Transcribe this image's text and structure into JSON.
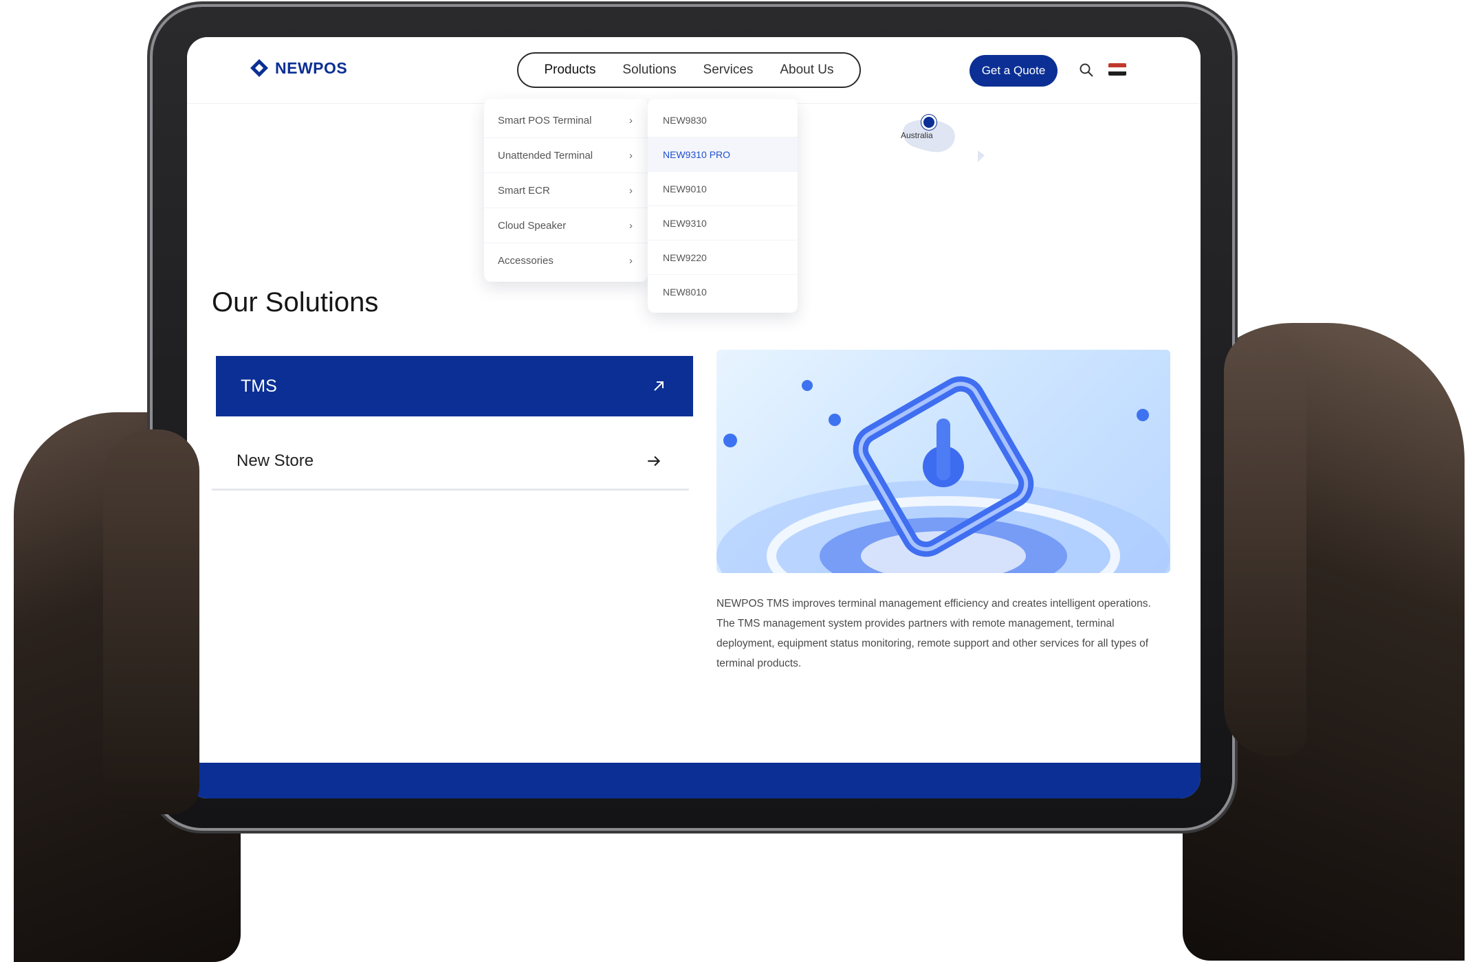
{
  "header": {
    "logo_text": "NEWPOS",
    "nav": [
      "Products",
      "Solutions",
      "Services",
      "About Us"
    ],
    "quote_button": "Get a Quote"
  },
  "products_menu": {
    "categories": [
      "Smart POS Terminal",
      "Unattended Terminal",
      "Smart ECR",
      "Cloud Speaker",
      "Accessories"
    ],
    "models": [
      "NEW9830",
      "NEW9310 PRO",
      "NEW9010",
      "NEW9310",
      "NEW9220",
      "NEW8010"
    ],
    "active_model_index": 1
  },
  "map": {
    "label": "Australia"
  },
  "solutions": {
    "title": "Our Solutions",
    "tabs": [
      "TMS",
      "New Store"
    ],
    "active_tab": "TMS",
    "description": "NEWPOS TMS improves terminal management efficiency and creates intelligent operations. The TMS management system provides partners with remote management, terminal deployment, equipment status monitoring, remote support and other services for all types of terminal products."
  },
  "colors": {
    "brand": "#0b2f94",
    "accent_link": "#1f4fd0"
  },
  "icons": [
    "logo-diamond-icon",
    "search-icon",
    "flag-icon",
    "chevron-right-icon",
    "arrow-up-right-icon",
    "arrow-right-icon",
    "map-pin-icon"
  ]
}
